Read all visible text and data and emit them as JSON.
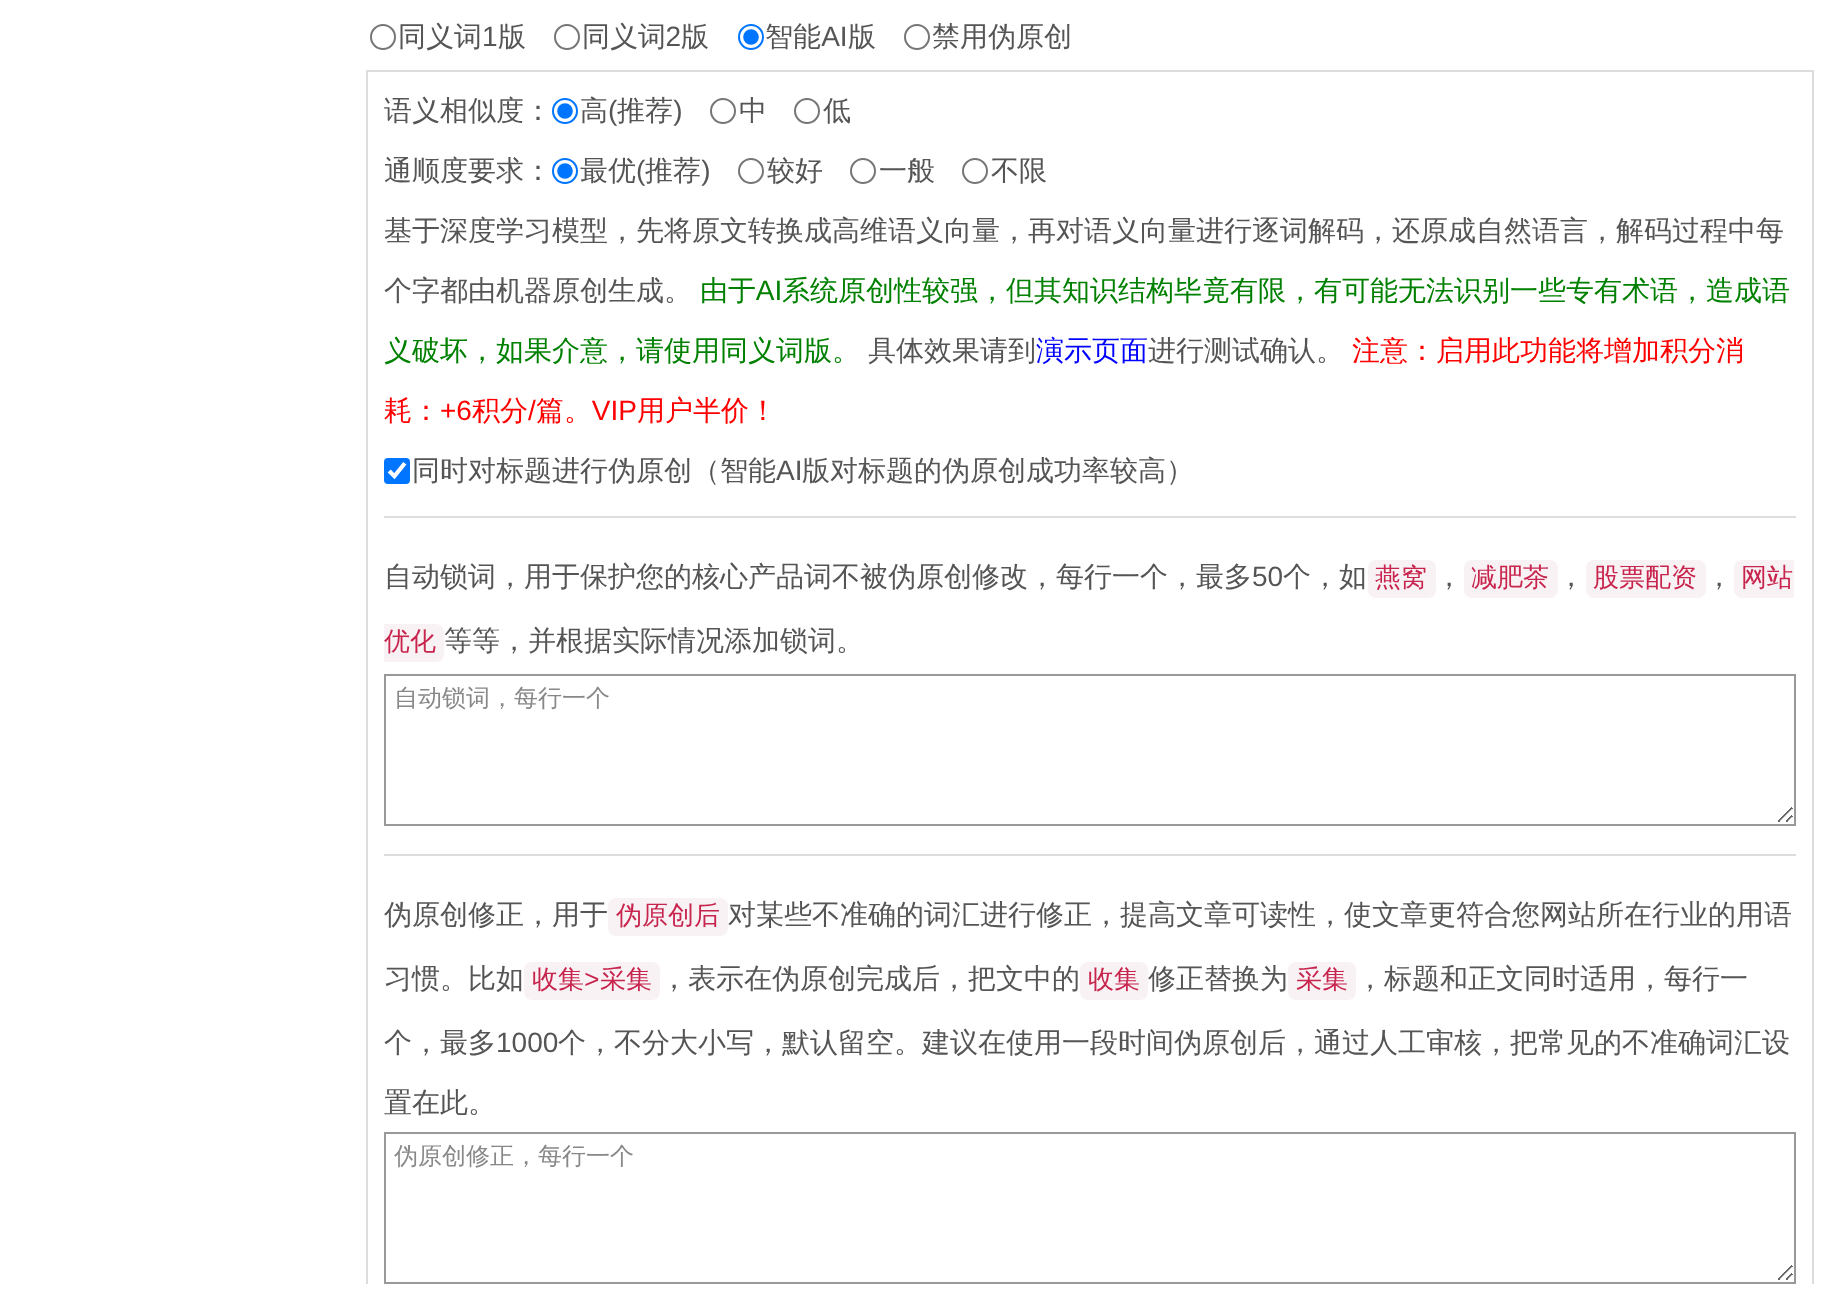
{
  "mode_options": [
    {
      "label": "同义词1版",
      "selected": false
    },
    {
      "label": "同义词2版",
      "selected": false
    },
    {
      "label": "智能AI版",
      "selected": true
    },
    {
      "label": "禁用伪原创",
      "selected": false
    }
  ],
  "ai_settings": {
    "groups": [
      {
        "label": "语义相似度：",
        "options": [
          {
            "label": "高(推荐)",
            "selected": true
          },
          {
            "label": "中",
            "selected": false
          },
          {
            "label": "低",
            "selected": false
          }
        ]
      },
      {
        "label": "通顺度要求：",
        "options": [
          {
            "label": "最优(推荐)",
            "selected": true
          },
          {
            "label": "较好",
            "selected": false
          },
          {
            "label": "一般",
            "selected": false
          },
          {
            "label": "不限",
            "selected": false
          }
        ]
      }
    ],
    "description": [
      {
        "kind": "text",
        "text": "基于深度学习模型，先将原文转换成高维语义向量，再对语义向量进行逐词解码，还原成自然语言，解码过程中每个字都由机器原创生成。 "
      },
      {
        "kind": "green",
        "text": "由于AI系统原创性较强，但其知识结构毕竟有限，有可能无法识别一些专有术语，造成语义破坏，如果介意，请使用同义词版。"
      },
      {
        "kind": "text",
        "text": " 具体效果请到"
      },
      {
        "kind": "link",
        "text": "演示页面"
      },
      {
        "kind": "text",
        "text": "进行测试确认。 "
      },
      {
        "kind": "red",
        "text": "注意：启用此功能将增加积分消耗：+6积分/篇。VIP用户半价！"
      }
    ],
    "title_option": {
      "label": "同时对标题进行伪原创（智能AI版对标题的伪原创成功率较高）",
      "checked": true
    }
  },
  "lock_words": {
    "description": [
      {
        "kind": "text",
        "text": "自动锁词，用于保护您的核心产品词不被伪原创修改，每行一个，最多50个，如"
      },
      {
        "kind": "code",
        "text": "燕窝"
      },
      {
        "kind": "text",
        "text": "，"
      },
      {
        "kind": "code",
        "text": "减肥茶"
      },
      {
        "kind": "text",
        "text": "，"
      },
      {
        "kind": "code",
        "text": "股票配资"
      },
      {
        "kind": "text",
        "text": "，"
      },
      {
        "kind": "code",
        "text": "网站优化"
      },
      {
        "kind": "text",
        "text": "等等，并根据实际情况添加锁词。"
      }
    ],
    "placeholder": "自动锁词，每行一个"
  },
  "corrections": {
    "description": [
      {
        "kind": "text",
        "text": "伪原创修正，用于"
      },
      {
        "kind": "code",
        "text": "伪原创后"
      },
      {
        "kind": "text",
        "text": "对某些不准确的词汇进行修正，提高文章可读性，使文章更符合您网站所在行业的用语习惯。比如"
      },
      {
        "kind": "code",
        "text": "收集>采集"
      },
      {
        "kind": "text",
        "text": "，表示在伪原创完成后，把文中的"
      },
      {
        "kind": "code",
        "text": "收集"
      },
      {
        "kind": "text",
        "text": "修正替换为"
      },
      {
        "kind": "code",
        "text": "采集"
      },
      {
        "kind": "text",
        "text": "，标题和正文同时适用，每行一个，最多1000个，不分大小写，默认留空。建议在使用一段时间伪原创后，通过人工审核，把常见的不准确词汇设置在此。"
      }
    ],
    "placeholder": "伪原创修正，每行一个"
  }
}
